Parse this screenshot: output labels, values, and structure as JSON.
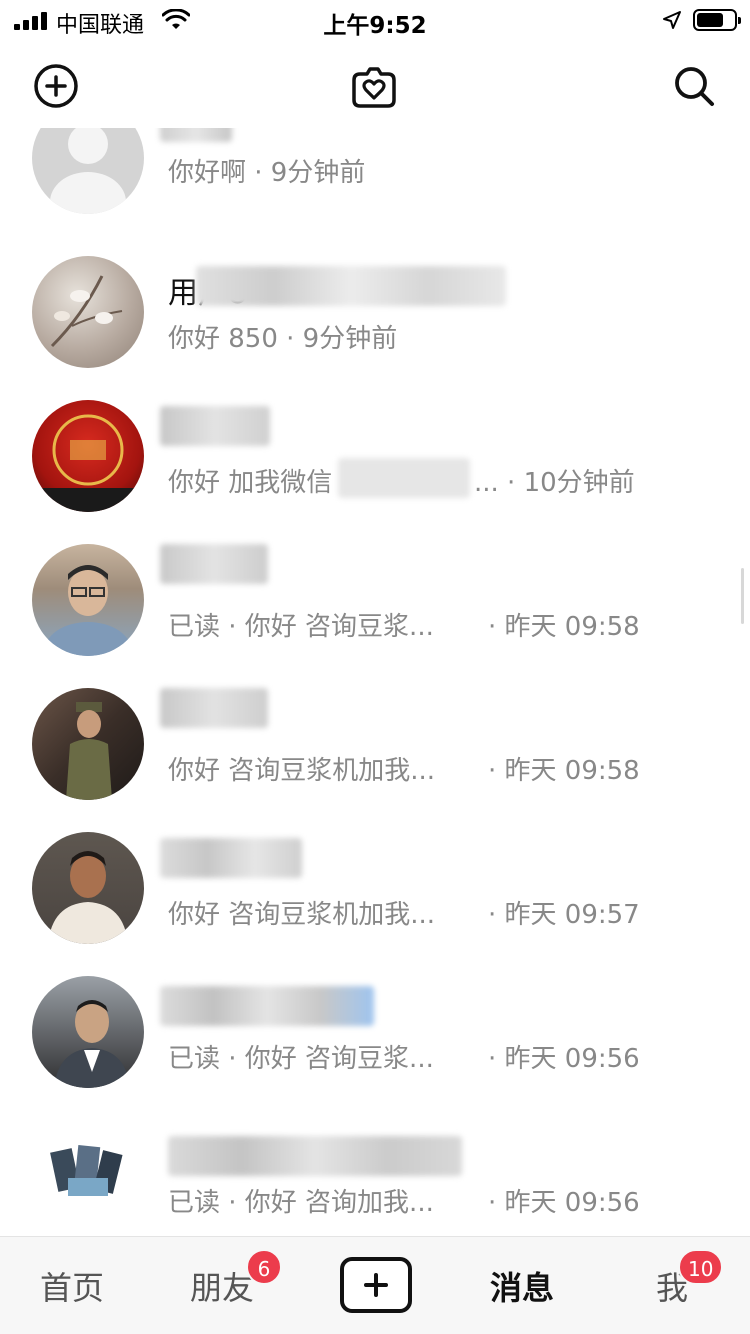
{
  "status_bar": {
    "carrier": "中国联通",
    "time": "上午9:52"
  },
  "top_nav": {
    "left_icon": "add-circle-icon",
    "center_icon": "heart-camera-icon",
    "right_icon": "search-icon"
  },
  "chats": [
    {
      "name": "",
      "preview": "你好啊 · 9分钟前",
      "time": ""
    },
    {
      "name": "用户8",
      "preview": "你好 850 · 9分钟前",
      "time": ""
    },
    {
      "name": "",
      "preview": "你好 加我微信",
      "time": "... · 10分钟前"
    },
    {
      "name": "",
      "preview": "已读 · 你好 咨询豆浆...",
      "time": "· 昨天 09:58"
    },
    {
      "name": "",
      "preview": "你好 咨询豆浆机加我...",
      "time": "· 昨天 09:58"
    },
    {
      "name": "",
      "preview": "你好 咨询豆浆机加我...",
      "time": "· 昨天 09:57"
    },
    {
      "name": "",
      "preview": "已读 · 你好 咨询豆浆...",
      "time": "· 昨天 09:56"
    },
    {
      "name": "",
      "preview": "已读 · 你好 咨询加我...",
      "time": "· 昨天 09:56"
    }
  ],
  "tab_bar": {
    "home": "首页",
    "friends": "朋友",
    "friends_badge": "6",
    "messages": "消息",
    "me": "我",
    "me_badge": "10"
  },
  "colors": {
    "badge": "#ec3c4c",
    "muted_text": "#888888",
    "tab_bar_bg": "#f7f7f7"
  }
}
